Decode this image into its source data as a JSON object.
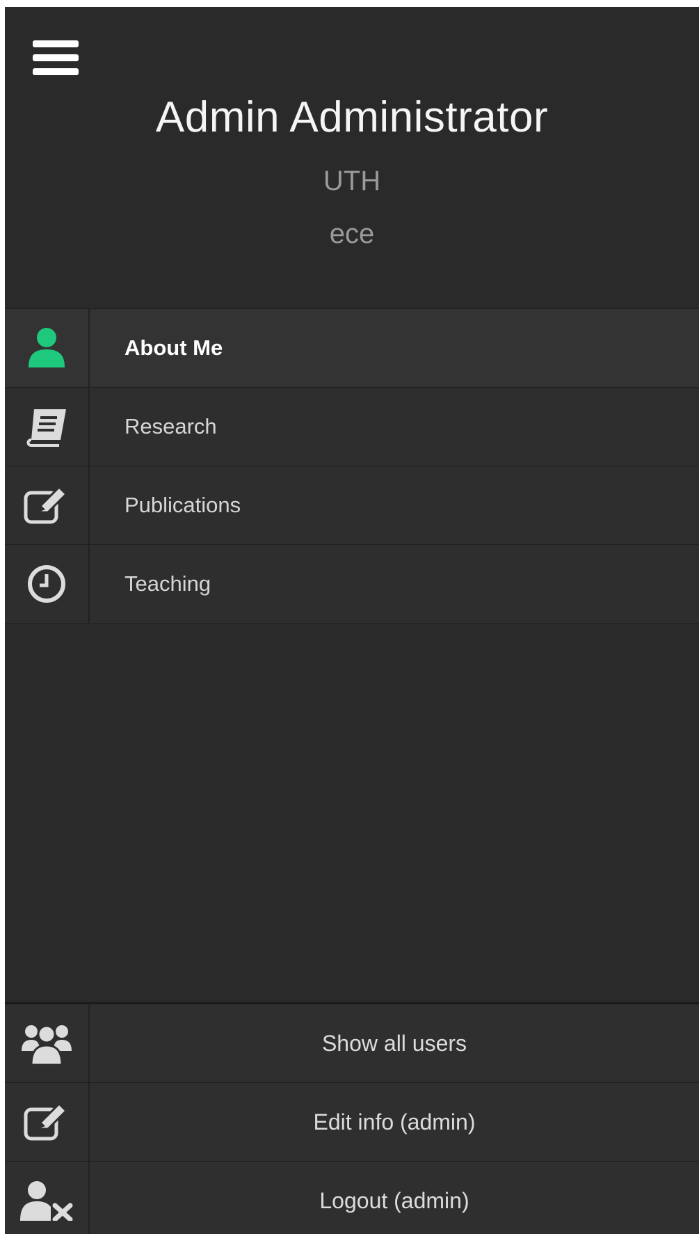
{
  "header": {
    "menu_icon": "hamburger-menu-icon",
    "name": "Admin Administrator",
    "organization": "UTH",
    "department": "ece"
  },
  "nav": {
    "items": [
      {
        "label": "About Me",
        "icon": "user-icon",
        "active": true,
        "icon_color": "#1ec97e"
      },
      {
        "label": "Research",
        "icon": "book-icon",
        "active": false,
        "icon_color": "#dcdcdc"
      },
      {
        "label": "Publications",
        "icon": "edit-icon",
        "active": false,
        "icon_color": "#dcdcdc"
      },
      {
        "label": "Teaching",
        "icon": "clock-icon",
        "active": false,
        "icon_color": "#dcdcdc"
      }
    ]
  },
  "footer": {
    "items": [
      {
        "label": "Show all users",
        "icon": "users-icon"
      },
      {
        "label": "Edit info (admin)",
        "icon": "edit-icon"
      },
      {
        "label": "Logout (admin)",
        "icon": "user-remove-icon"
      }
    ]
  },
  "colors": {
    "background": "#2a2a2a",
    "accent": "#1ec97e",
    "text": "#d6d6d6",
    "muted": "#9a9a9a"
  }
}
